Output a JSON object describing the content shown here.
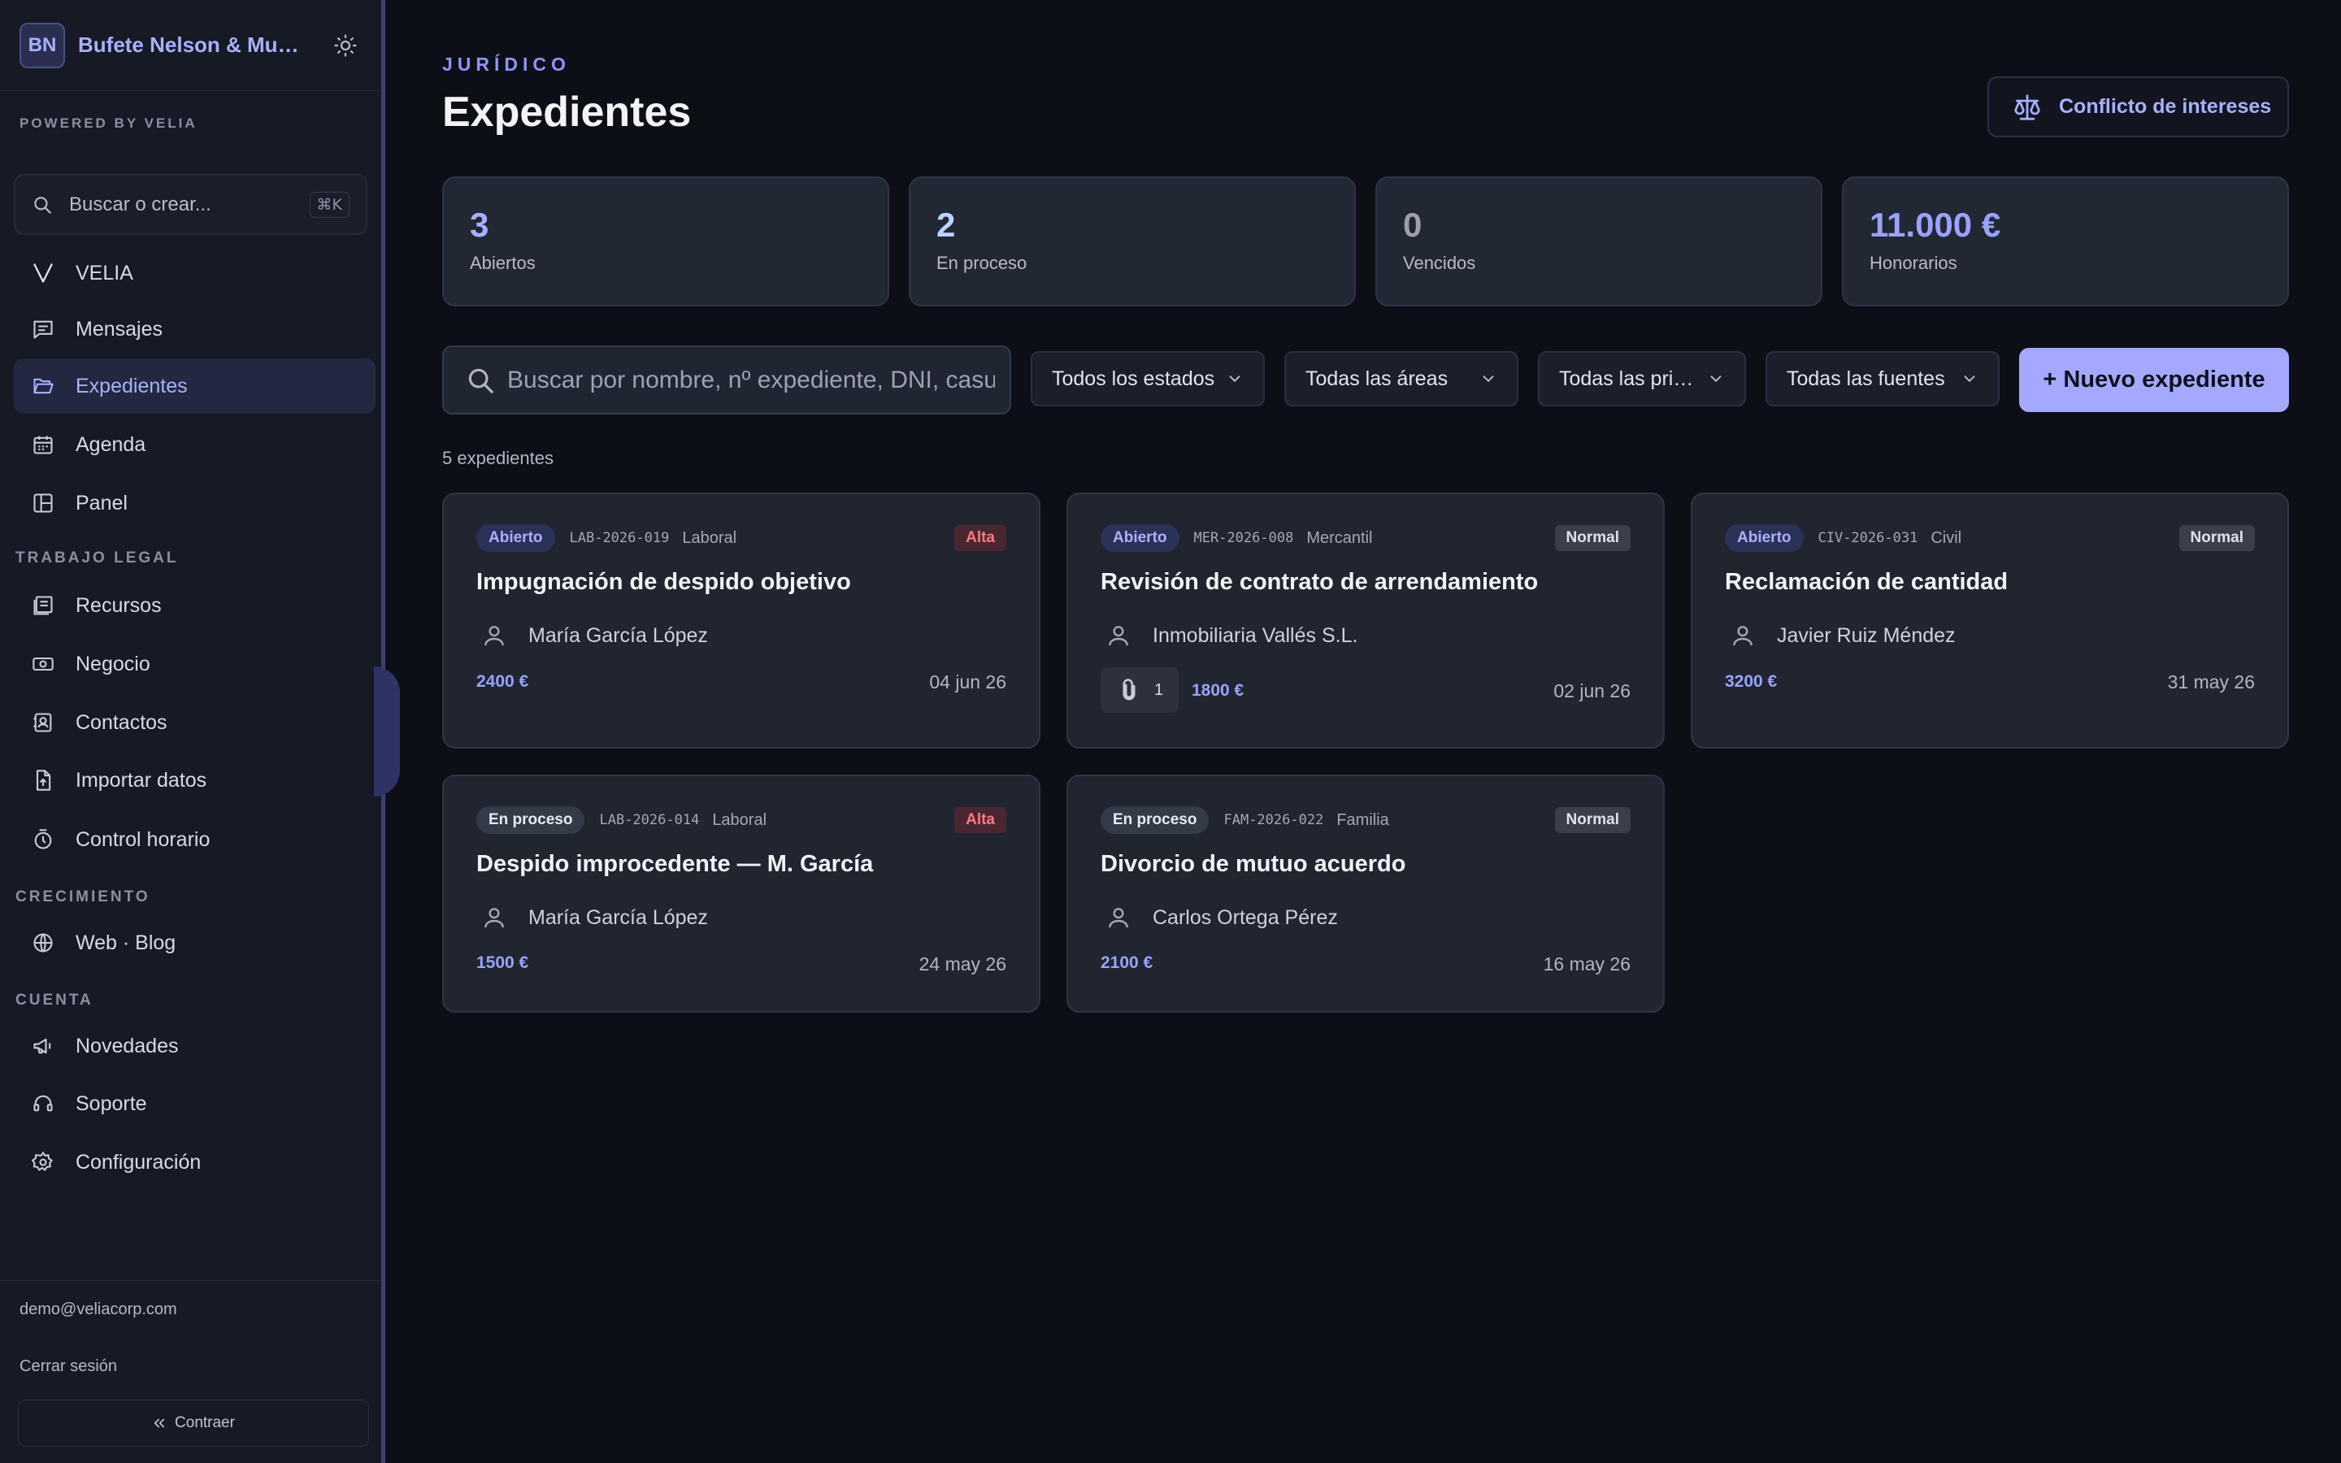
{
  "sidebar": {
    "workspace_initials": "BN",
    "workspace_name": "Bufete Nelson & Murdock",
    "powered_by": "POWERED BY VELIA",
    "search_label": "Buscar o crear...",
    "search_shortcut": "⌘K",
    "items": [
      {
        "label": "VELIA",
        "icon": "velia-logo-icon"
      },
      {
        "label": "Mensajes",
        "icon": "message-icon"
      },
      {
        "label": "Expedientes",
        "icon": "folder-open-icon",
        "active": true
      },
      {
        "label": "Agenda",
        "icon": "calendar-icon"
      },
      {
        "label": "Panel",
        "icon": "layout-icon"
      },
      {
        "label": "Recursos",
        "icon": "library-icon"
      },
      {
        "label": "Negocio",
        "icon": "banknote-icon"
      },
      {
        "label": "Contactos",
        "icon": "contacts-icon"
      },
      {
        "label": "Importar datos",
        "icon": "file-import-icon"
      },
      {
        "label": "Control horario",
        "icon": "timer-icon"
      },
      {
        "label": "Web · Blog",
        "icon": "globe-icon"
      },
      {
        "label": "Novedades",
        "icon": "megaphone-icon"
      },
      {
        "label": "Soporte",
        "icon": "headset-icon"
      },
      {
        "label": "Configuración",
        "icon": "gear-icon"
      }
    ],
    "sections": [
      "TRABAJO LEGAL",
      "CRECIMIENTO",
      "CUENTA"
    ],
    "email": "demo@veliacorp.com",
    "logout": "Cerrar sesión",
    "collapse": "Contraer"
  },
  "header": {
    "eyebrow": "JURÍDICO",
    "title": "Expedientes",
    "conflict_button": "Conflicto de intereses"
  },
  "stats": [
    {
      "value": "3",
      "label": "Abiertos",
      "color": "#a9b0ff"
    },
    {
      "value": "2",
      "label": "En proceso",
      "color": "#b9d4ff"
    },
    {
      "value": "0",
      "label": "Vencidos",
      "color": "#9ca0ad"
    },
    {
      "value": "11.000 €",
      "label": "Honorarios",
      "color": "#9aa2ff"
    }
  ],
  "toolbar": {
    "search_placeholder": "Buscar por nombre, nº expediente, DNI, casuística...",
    "filters": [
      "Todos los estados",
      "Todas las áreas",
      "Todas las prioridades",
      "Todas las fuentes"
    ],
    "new_button": "+ Nuevo expediente"
  },
  "count_label": "5 expedientes",
  "cases": [
    {
      "status": "Abierto",
      "code": "LAB-2026-019",
      "area": "Laboral",
      "priority": "Alta",
      "title": "Impugnación de despido objetivo",
      "client": "María García López",
      "amount": "2400 €",
      "date": "04 jun 26"
    },
    {
      "status": "Abierto",
      "code": "MER-2026-008",
      "area": "Mercantil",
      "priority": "Normal",
      "title": "Revisión de contrato de arrendamiento",
      "client": "Inmobiliaria Vallés S.L.",
      "attachments": "1",
      "amount": "1800 €",
      "date": "02 jun 26"
    },
    {
      "status": "Abierto",
      "code": "CIV-2026-031",
      "area": "Civil",
      "priority": "Normal",
      "title": "Reclamación de cantidad",
      "client": "Javier Ruiz Méndez",
      "amount": "3200 €",
      "date": "31 may 26"
    },
    {
      "status": "En proceso",
      "code": "LAB-2026-014",
      "area": "Laboral",
      "priority": "Alta",
      "title": "Despido improcedente — M. García",
      "client": "María García López",
      "amount": "1500 €",
      "date": "24 may 26"
    },
    {
      "status": "En proceso",
      "code": "FAM-2026-022",
      "area": "Familia",
      "priority": "Normal",
      "title": "Divorcio de mutuo acuerdo",
      "client": "Carlos Ortega Pérez",
      "amount": "2100 €",
      "date": "16 may 26"
    }
  ],
  "colors": {
    "accent": "#a4a9ff",
    "background": "#0d0f16",
    "sidebar": "#161a24",
    "card": "#202530",
    "alta": "#ff7783"
  }
}
